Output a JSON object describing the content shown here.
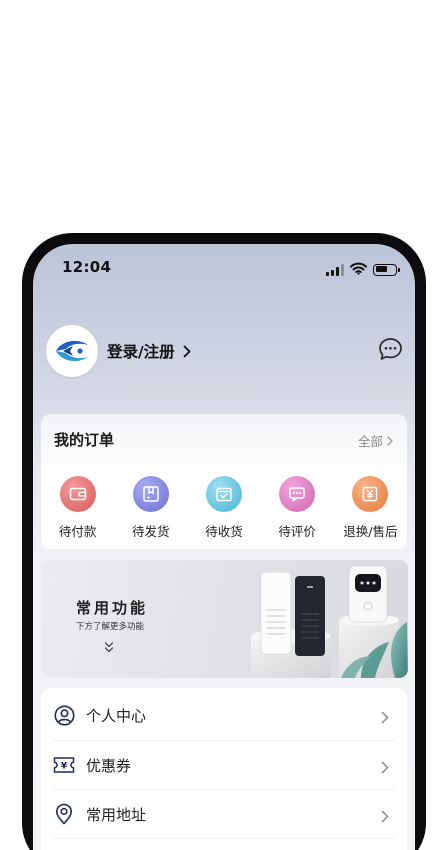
{
  "status_bar": {
    "time": "12:04"
  },
  "profile": {
    "login_label": "登录/注册"
  },
  "orders": {
    "title": "我的订单",
    "all_label": "全部",
    "items": [
      {
        "label": "待付款",
        "icon": "wallet-icon",
        "color": "#e77373"
      },
      {
        "label": "待发货",
        "icon": "package-icon",
        "color": "#7f84e0"
      },
      {
        "label": "待收货",
        "icon": "receive-box-icon",
        "color": "#5bc0de"
      },
      {
        "label": "待评价",
        "icon": "comment-icon",
        "color": "#dc74be"
      },
      {
        "label": "退换/售后",
        "icon": "refund-icon",
        "color": "#ef8a4e"
      }
    ]
  },
  "banner": {
    "title": "常用功能",
    "subtitle": "下方了解更多功能"
  },
  "menu": {
    "items": [
      {
        "label": "个人中心",
        "icon": "user-icon"
      },
      {
        "label": "优惠券",
        "icon": "coupon-icon"
      },
      {
        "label": "常用地址",
        "icon": "location-pin-icon"
      }
    ]
  },
  "colors": {
    "brand_blue": "#1f5fbf",
    "header_gradient_top": "#bcc4d8",
    "page_bg": "#f3f4f6"
  }
}
